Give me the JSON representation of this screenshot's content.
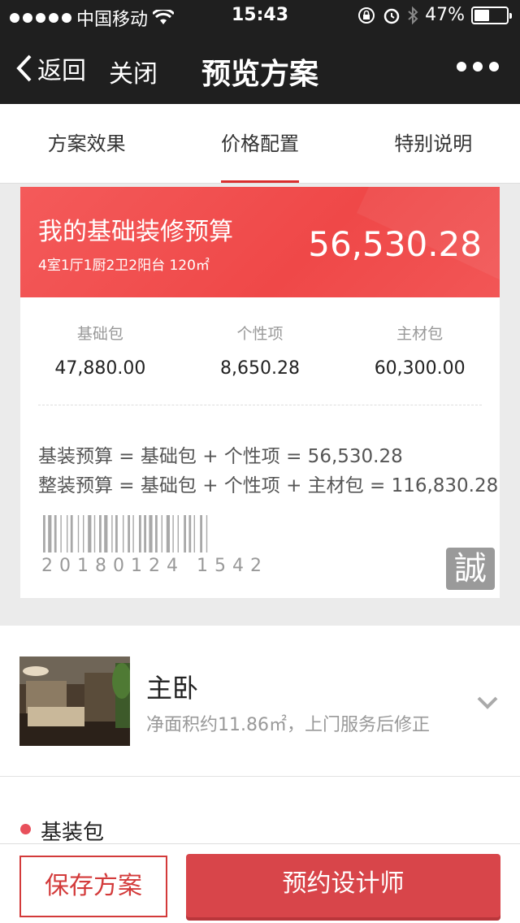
{
  "status_bar": {
    "carrier": "中国移动",
    "time": "15:43",
    "battery": "47%",
    "battery_level": 0.47
  },
  "nav": {
    "back_label": "返回",
    "close_label": "关闭",
    "title": "预览方案"
  },
  "tabs": [
    {
      "label": "方案效果"
    },
    {
      "label": "价格配置"
    },
    {
      "label": "特别说明"
    }
  ],
  "budget": {
    "title": "我的基础装修预算",
    "layout": "4室1厅1厨2卫2阳台 120㎡",
    "amount": "56,530.28",
    "columns": [
      {
        "label": "基础包",
        "value": "47,880.00"
      },
      {
        "label": "个性项",
        "value": "8,650.28"
      },
      {
        "label": "主材包",
        "value": "60,300.00"
      }
    ],
    "formula_1": "基装预算 = 基础包 + 个性项 = 56,530.28",
    "formula_2": "整装预算 = 基础包 + 个性项 + 主材包 = 116,830.28",
    "barcode_number": "20180124 1542",
    "seal_text": "誠"
  },
  "room": {
    "title": "主卧",
    "subtitle": "净面积约11.86㎡，上门服务后修正"
  },
  "package": {
    "label": "基装包"
  },
  "buttons": {
    "save_label": "保存方案",
    "book_label": "预约设计师"
  },
  "colors": {
    "accent": "#d8454a",
    "header_bg": "#1f1f1f",
    "card_red": "#f04a4a"
  }
}
